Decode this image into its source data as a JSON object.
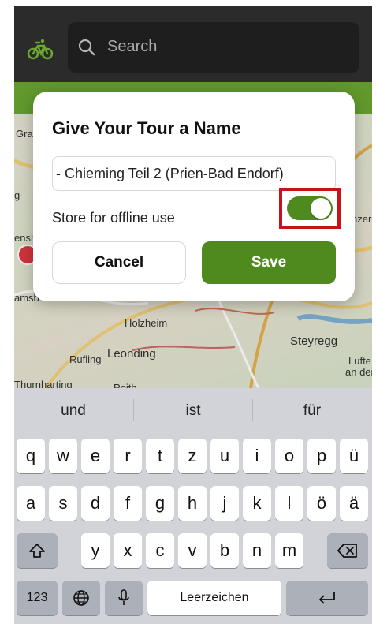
{
  "search": {
    "placeholder": "Search"
  },
  "map": {
    "labels": {
      "gra": "Gra",
      "g": "g",
      "ensh": "ensh",
      "amsb": "amsb",
      "nzer": "nzer",
      "holzheim": "Holzheim",
      "steyregg": "Steyregg",
      "rufling": "Rufling",
      "leonding": "Leonding",
      "lufte": "Lufte",
      "ander": "an der",
      "thurnharting": "Thurnharting",
      "poith": "Poith"
    }
  },
  "dialog": {
    "title": "Give Your Tour a Name",
    "name_value": "- Chieming Teil 2 (Prien-Bad Endorf)",
    "offline_label": "Store for offline use",
    "offline_enabled": true,
    "cancel_label": "Cancel",
    "save_label": "Save"
  },
  "keyboard": {
    "suggestions": [
      "und",
      "ist",
      "für"
    ],
    "row1": [
      "q",
      "w",
      "e",
      "r",
      "t",
      "z",
      "u",
      "i",
      "o",
      "p",
      "ü"
    ],
    "row2": [
      "a",
      "s",
      "d",
      "f",
      "g",
      "h",
      "j",
      "k",
      "l",
      "ö",
      "ä"
    ],
    "row3": [
      "y",
      "x",
      "c",
      "v",
      "b",
      "n",
      "m"
    ],
    "numbers_key": "123",
    "space_label": "Leerzeichen"
  },
  "colors": {
    "accent_green": "#4f8a1f",
    "highlight_red": "#c3141b",
    "bar_green": "#6aa630"
  }
}
